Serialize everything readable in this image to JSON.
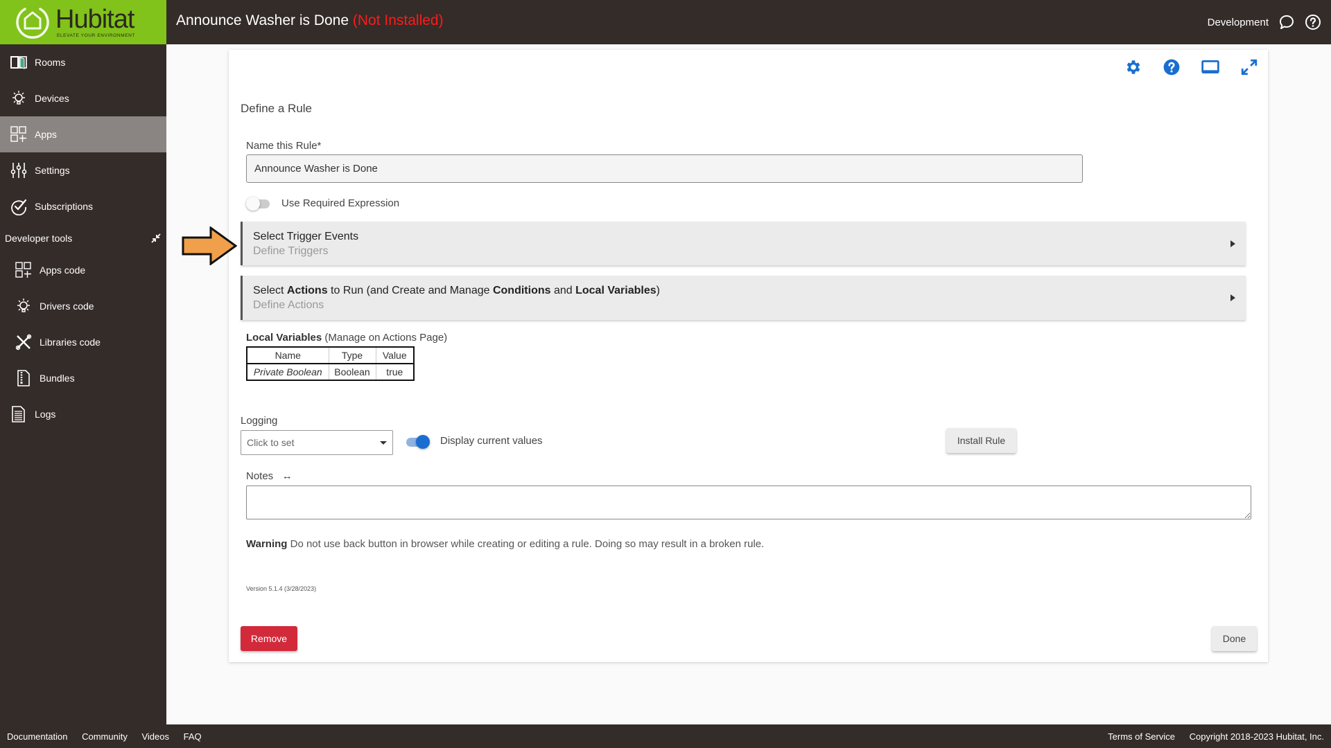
{
  "header": {
    "logo": {
      "name": "Hubitat",
      "tagline": "ELEVATE YOUR ENVIRONMENT",
      "brand_color": "#81c21b"
    },
    "title": "Announce Washer is Done",
    "status": "(Not Installed)",
    "status_color": "#ff1a1a",
    "environment": "Development",
    "icons": [
      "chat-icon",
      "help-icon"
    ]
  },
  "sidebar": {
    "items": [
      {
        "label": "Rooms",
        "icon": "rooms-icon",
        "active": false
      },
      {
        "label": "Devices",
        "icon": "devices-icon",
        "active": false
      },
      {
        "label": "Apps",
        "icon": "apps-icon",
        "active": true
      },
      {
        "label": "Settings",
        "icon": "settings-icon",
        "active": false
      },
      {
        "label": "Subscriptions",
        "icon": "subscriptions-icon",
        "active": false
      }
    ],
    "dev_tools_label": "Developer tools",
    "dev_items": [
      {
        "label": "Apps code",
        "icon": "apps-code-icon"
      },
      {
        "label": "Drivers code",
        "icon": "drivers-code-icon"
      },
      {
        "label": "Libraries code",
        "icon": "libraries-code-icon"
      },
      {
        "label": "Bundles",
        "icon": "bundles-icon"
      }
    ],
    "logs_label": "Logs"
  },
  "panel": {
    "tool_icons": [
      "gear-icon",
      "help-icon",
      "display-icon",
      "expand-icon"
    ],
    "title": "Define a Rule",
    "name_label": "Name this Rule*",
    "name_value": "Announce Washer is Done",
    "required_expression_label": "Use Required Expression",
    "required_expression_on": false,
    "trigger_section": {
      "title": "Select Trigger Events",
      "subtitle": "Define Triggers"
    },
    "actions_section": {
      "title_parts": [
        "Select ",
        "Actions",
        " to Run (and Create and Manage ",
        "Conditions",
        " and ",
        "Local Variables",
        ")"
      ],
      "subtitle": "Define Actions"
    },
    "local_variables": {
      "title": "Local Variables",
      "note": " (Manage on Actions Page)",
      "columns": [
        "Name",
        "Type",
        "Value"
      ],
      "rows": [
        {
          "name": "Private Boolean",
          "type": "Boolean",
          "value": "true"
        }
      ]
    },
    "logging_label": "Logging",
    "logging_value": "Click to set",
    "display_values_label": "Display current values",
    "display_values_on": true,
    "install_button": "Install Rule",
    "notes_label": "Notes",
    "notes_icon": "↔",
    "notes_value": "",
    "warning_label": "Warning",
    "warning_text": " Do not use back button in browser while creating or editing a rule. Doing so may result in a broken rule.",
    "version": "Version 5.1.4 (3/28/2023)",
    "remove_button": "Remove",
    "done_button": "Done",
    "accent_color": "#1a6ed0",
    "danger_color": "#d32a3b"
  },
  "footer": {
    "links": [
      "Documentation",
      "Community",
      "Videos",
      "FAQ"
    ],
    "terms": "Terms of Service",
    "copyright": "Copyright 2018-2023 Hubitat, Inc."
  }
}
